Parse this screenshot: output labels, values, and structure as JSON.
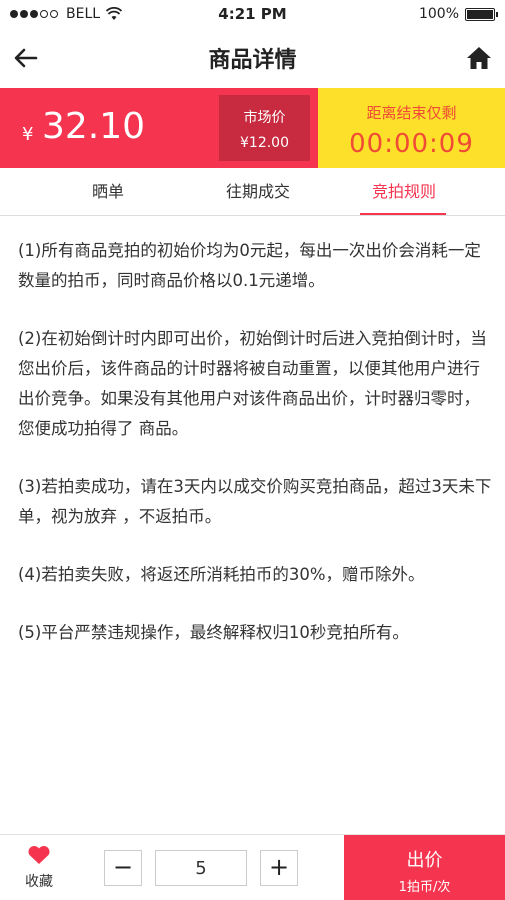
{
  "status_bar": {
    "carrier": "BELL",
    "time": "4:21 PM",
    "battery": "100%",
    "signal_bars": 3,
    "signal_total": 5
  },
  "nav": {
    "title": "商品详情",
    "back_icon": "arrow-left-icon",
    "home_icon": "home-icon"
  },
  "price": {
    "currency": "¥",
    "current": "32.10",
    "market_label": "市场价",
    "market_value": "¥12.00"
  },
  "countdown": {
    "label": "距离结束仅剩",
    "value": "00:00:09"
  },
  "tabs": [
    {
      "label": "晒单",
      "active": false
    },
    {
      "label": "往期成交",
      "active": false
    },
    {
      "label": "竞拍规则",
      "active": true
    }
  ],
  "rules": [
    "(1)所有商品竞拍的初始价均为0元起，每出一次出价会消耗一定数量的拍币，同时商品价格以0.1元递增。",
    "(2)在初始倒计时内即可出价，初始倒计时后进入竞拍倒计时，当您出价后，该件商品的计时器将被自动重置，以便其他用户进行出价竞争。如果没有其他用户对该件商品出价，计时器归零时，您便成功拍得了 商品。",
    "(3)若拍卖成功，请在3天内以成交价购买竞拍商品，超过3天未下单，视为放弃 ，不返拍币。",
    "(4)若拍卖失败，将返还所消耗拍币的30%，赠币除外。",
    "(5)平台严禁违规操作，最终解释权归10秒竞拍所有。"
  ],
  "bottom": {
    "fav_label": "收藏",
    "qty_minus": "−",
    "qty_value": "5",
    "qty_plus": "+",
    "bid_label": "出价",
    "bid_sub": "1拍币/次"
  },
  "colors": {
    "accent": "#f5344f",
    "market_bg": "#c82a3f",
    "countdown_bg": "#fde02a",
    "countdown_text": "#f04b35"
  }
}
